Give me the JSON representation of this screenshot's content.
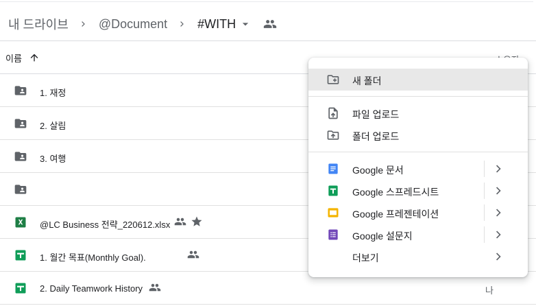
{
  "breadcrumb": {
    "items": [
      "내 드라이브",
      "@Document",
      "#WITH"
    ]
  },
  "list_header": {
    "name_label": "이름",
    "owner_label": "소유자"
  },
  "files": [
    {
      "name": "1. 재정",
      "type": "shared-folder",
      "shared": false,
      "starred": false,
      "owner": ""
    },
    {
      "name": "2. 살림",
      "type": "shared-folder",
      "shared": false,
      "starred": false,
      "owner": ""
    },
    {
      "name": "3. 여행",
      "type": "shared-folder",
      "shared": false,
      "starred": false,
      "owner": ""
    },
    {
      "name": "",
      "type": "shared-folder",
      "shared": false,
      "starred": false,
      "owner": ""
    },
    {
      "name": "@LC Business 전략_220612.xlsx",
      "type": "excel",
      "shared": true,
      "starred": true,
      "owner": ""
    },
    {
      "name": "1. 월간 목표(Monthly Goal).",
      "type": "sheets",
      "shared": true,
      "starred": false,
      "owner": ""
    },
    {
      "name": "2. Daily Teamwork History",
      "type": "sheets",
      "shared": true,
      "starred": false,
      "owner": "나"
    }
  ],
  "new_menu": {
    "items": [
      {
        "label": "새 폴더",
        "icon": "new-folder-icon",
        "group": 1
      },
      {
        "label": "파일 업로드",
        "icon": "file-upload-icon",
        "group": 2
      },
      {
        "label": "폴더 업로드",
        "icon": "folder-upload-icon",
        "group": 2
      },
      {
        "label": "Google 문서",
        "icon": "google-docs-icon",
        "group": 3,
        "submenu": true
      },
      {
        "label": "Google 스프레드시트",
        "icon": "google-sheets-icon",
        "group": 3,
        "submenu": true
      },
      {
        "label": "Google 프레젠테이션",
        "icon": "google-slides-icon",
        "group": 3,
        "submenu": true
      },
      {
        "label": "Google 설문지",
        "icon": "google-forms-icon",
        "group": 3,
        "submenu": true
      },
      {
        "label": "더보기",
        "icon": "",
        "group": 3,
        "submenu": true
      }
    ]
  },
  "colors": {
    "docs": "#4285f4",
    "sheets": "#0f9d58",
    "slides": "#f4b400",
    "forms": "#7248b9",
    "excel": "#1e7e45",
    "icon_gray": "#5f6368"
  }
}
